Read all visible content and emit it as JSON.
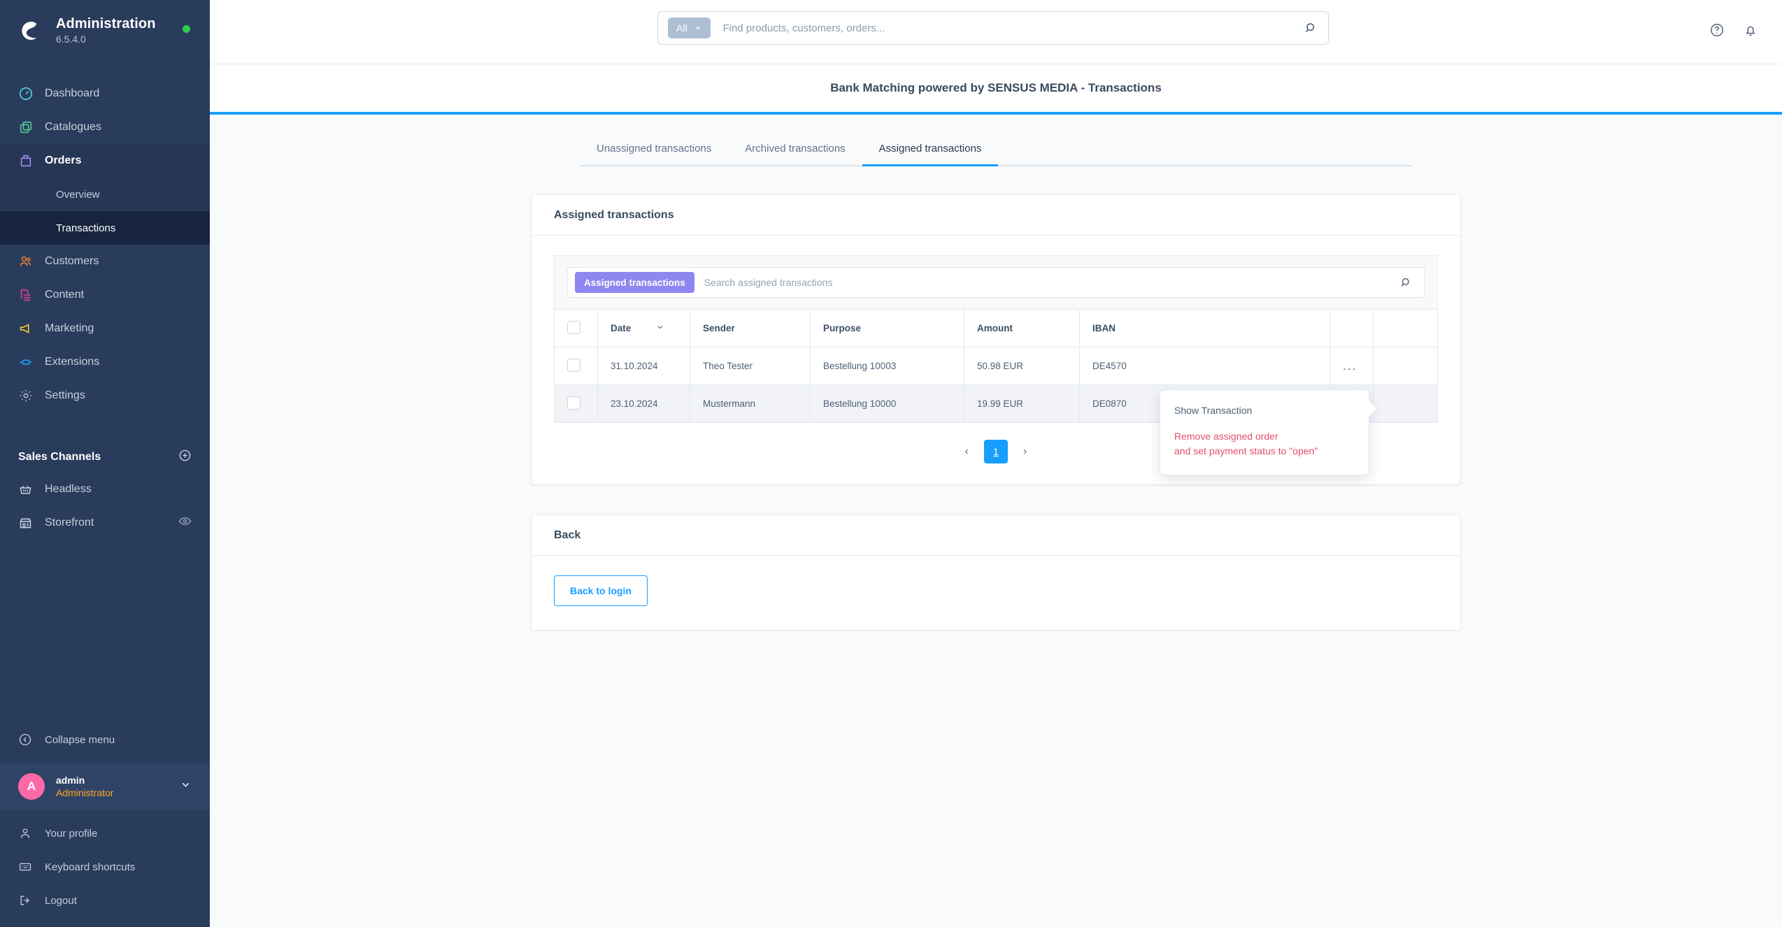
{
  "sidebar": {
    "brand": {
      "title": "Administration",
      "version": "6.5.4.0",
      "status_color": "#2ecc4f"
    },
    "nav": [
      {
        "label": "Dashboard",
        "icon": "dashboard-icon",
        "color": "#57d9f0"
      },
      {
        "label": "Catalogues",
        "icon": "catalogues-icon",
        "color": "#4ed19a"
      },
      {
        "label": "Orders",
        "icon": "orders-icon",
        "color": "#a78bfa"
      },
      {
        "label": "Customers",
        "icon": "customers-icon",
        "color": "#f0803c"
      },
      {
        "label": "Content",
        "icon": "content-icon",
        "color": "#f0399a"
      },
      {
        "label": "Marketing",
        "icon": "marketing-icon",
        "color": "#f5d327"
      },
      {
        "label": "Extensions",
        "icon": "extensions-icon",
        "color": "#1fa2ff"
      },
      {
        "label": "Settings",
        "icon": "settings-icon",
        "color": "#aebdcf"
      }
    ],
    "orders_sub": [
      {
        "label": "Overview"
      },
      {
        "label": "Transactions"
      }
    ],
    "sales_channels": {
      "heading": "Sales Channels",
      "items": [
        {
          "label": "Headless",
          "icon": "basket-icon"
        },
        {
          "label": "Storefront",
          "icon": "store-icon"
        }
      ]
    },
    "collapse": {
      "label": "Collapse menu",
      "icon": "collapse-icon"
    },
    "user": {
      "initial": "A",
      "name": "admin",
      "role": "Administrator"
    },
    "bottom": [
      {
        "label": "Your profile",
        "icon": "person-icon"
      },
      {
        "label": "Keyboard shortcuts",
        "icon": "keyboard-icon"
      },
      {
        "label": "Logout",
        "icon": "logout-icon"
      }
    ]
  },
  "topbar": {
    "scope_label": "All",
    "search_placeholder": "Find products, customers, orders...",
    "search_value": "",
    "icons": [
      "help-icon",
      "notifications-icon"
    ]
  },
  "page": {
    "title": "Bank Matching powered by SENSUS MEDIA - Transactions",
    "accent_color": "#189eff"
  },
  "tabs": [
    {
      "label": "Unassigned transactions",
      "active": false
    },
    {
      "label": "Archived transactions",
      "active": false
    },
    {
      "label": "Assigned transactions",
      "active": true
    }
  ],
  "grid_card": {
    "heading": "Assigned transactions",
    "filter_pill": "Assigned transactions",
    "search_placeholder": "Search assigned transactions",
    "search_value": "",
    "columns": [
      "Date",
      "Sender",
      "Purpose",
      "Amount",
      "IBAN"
    ],
    "rows": [
      {
        "date": "31.10.2024",
        "sender": "Theo Tester",
        "purpose": "Bestellung 10003",
        "amount": "50.98 EUR",
        "iban": "DE4570"
      },
      {
        "date": "23.10.2024",
        "sender": "Mustermann",
        "purpose": "Bestellung 10000",
        "amount": "19.99 EUR",
        "iban": "DE0870"
      }
    ],
    "row_action_label": "...",
    "pagination": {
      "prev": "‹",
      "page": "1",
      "next": "›"
    }
  },
  "context_menu": {
    "item_show": "Show Transaction",
    "item_remove_line1": "Remove assigned order",
    "item_remove_line2": "and set payment status to \"open\"",
    "danger_color": "#e3506b"
  },
  "back_card": {
    "heading": "Back",
    "button_label": "Back to login"
  }
}
